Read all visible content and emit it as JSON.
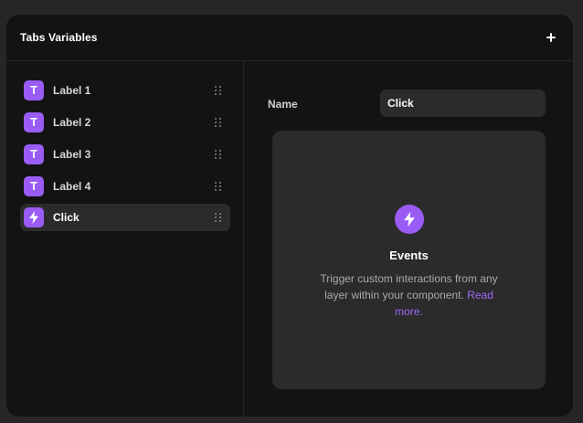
{
  "header": {
    "title": "Tabs Variables",
    "add_icon": "plus-icon"
  },
  "sidebar": {
    "items": [
      {
        "label": "Label 1",
        "icon": "text-icon",
        "glyph": "T",
        "selected": false
      },
      {
        "label": "Label 2",
        "icon": "text-icon",
        "glyph": "T",
        "selected": false
      },
      {
        "label": "Label 3",
        "icon": "text-icon",
        "glyph": "T",
        "selected": false
      },
      {
        "label": "Label 4",
        "icon": "text-icon",
        "glyph": "T",
        "selected": false
      },
      {
        "label": "Click",
        "icon": "lightning-icon",
        "selected": true
      }
    ],
    "drag_icon": "drag-handle-icon"
  },
  "detail": {
    "name_label": "Name",
    "name_value": "Click",
    "events": {
      "icon": "lightning-icon",
      "title": "Events",
      "description": "Trigger custom interactions from any layer within your component.",
      "link_text": "Read more."
    }
  },
  "colors": {
    "accent": "#9a5cf5",
    "link": "#9a6bf5",
    "panel_bg": "#131313",
    "card_bg": "#2b2b2b",
    "page_bg": "#262626"
  }
}
